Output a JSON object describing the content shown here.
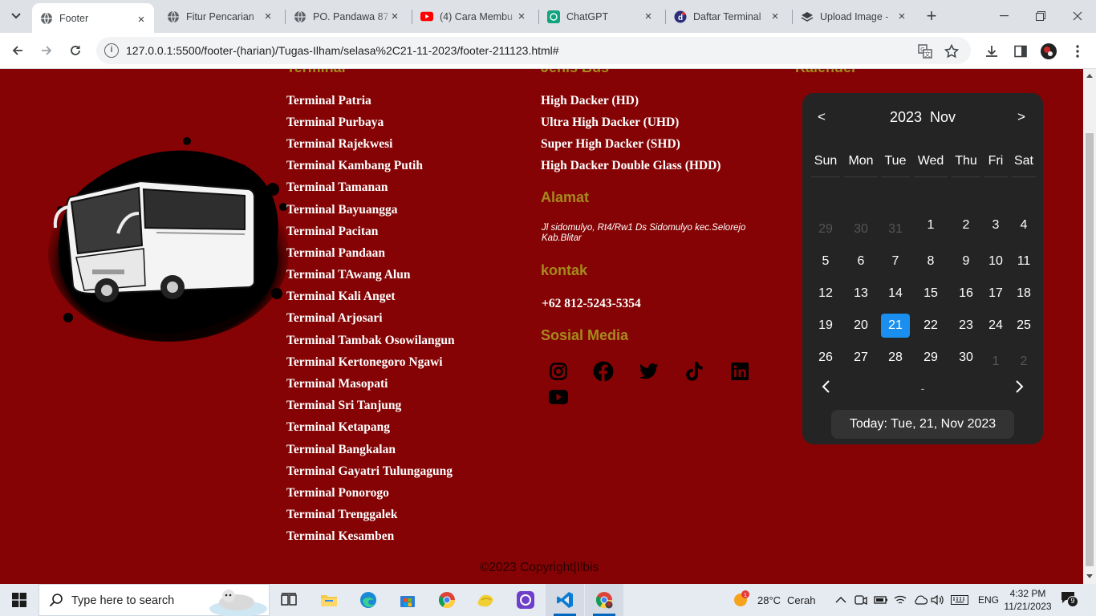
{
  "browser": {
    "tabs": [
      {
        "title": "Footer",
        "icon": "globe-icon",
        "active": true
      },
      {
        "title": "Fitur Pencarian",
        "icon": "globe-icon"
      },
      {
        "title": "PO. Pandawa 87",
        "icon": "globe-icon"
      },
      {
        "title": "(4) Cara Membu",
        "icon": "youtube-icon"
      },
      {
        "title": "ChatGPT",
        "icon": "chatgpt-icon"
      },
      {
        "title": "Daftar Terminal",
        "icon": "d-logo-icon"
      },
      {
        "title": "Upload Image -",
        "icon": "upload-icon"
      }
    ],
    "url": "127.0.0.1:5500/footer-(harian)/Tugas-Ilham/selasa%2C21-11-2023/footer-211123.html#"
  },
  "footer": {
    "terminal_heading": "Terminal",
    "terminals": [
      "Terminal Patria",
      "Terminal Purbaya",
      "Terminal Rajekwesi",
      "Terminal Kambang Putih",
      "Terminal Tamanan",
      "Terminal Bayuangga",
      "Terminal Pacitan",
      "Terminal Pandaan",
      "Terminal TAwang Alun",
      "Terminal Kali Anget",
      "Terminal Arjosari",
      "Terminal Tambak Osowilangun",
      "Terminal Kertonegoro Ngawi",
      "Terminal Masopati",
      "Terminal Sri Tanjung",
      "Terminal Ketapang",
      "Terminal Bangkalan",
      "Terminal Gayatri Tulungagung",
      "Terminal Ponorogo",
      "Terminal Trenggalek",
      "Terminal Kesamben"
    ],
    "jenis_heading": "Jenis Bus",
    "jenis": [
      "High Dacker (HD)",
      "Ultra High Dacker (UHD)",
      "Super High Dacker (SHD)",
      "High Dacker Double Glass (HDD)"
    ],
    "alamat_heading": "Alamat",
    "alamat": "Jl sidomulyo, Rt4/Rw1 Ds Sidomulyo kec.Selorejo Kab.Blitar",
    "kontak_heading": "kontak",
    "kontak": "+62 812-5243-5354",
    "sosmed_heading": "Sosial Media",
    "social_icons": [
      "instagram-icon",
      "facebook-icon",
      "twitter-icon",
      "tiktok-icon",
      "linkedin-icon",
      "youtube-icon"
    ],
    "kalender_heading": "Kalender",
    "copyright": "©2023 Copyright|Ilbis"
  },
  "calendar": {
    "prev": "<",
    "next": ">",
    "year": "2023",
    "month": "Nov",
    "weekdays": [
      "Sun",
      "Mon",
      "Tue",
      "Wed",
      "Thu",
      "Fri",
      "Sat"
    ],
    "weeks": [
      [
        "29",
        "30",
        "31",
        "1",
        "2",
        "3",
        "4"
      ],
      [
        "5",
        "6",
        "7",
        "8",
        "9",
        "10",
        "11"
      ],
      [
        "12",
        "13",
        "14",
        "15",
        "16",
        "17",
        "18"
      ],
      [
        "19",
        "20",
        "21",
        "22",
        "23",
        "24",
        "25"
      ],
      [
        "26",
        "27",
        "28",
        "29",
        "30",
        "1",
        "2"
      ]
    ],
    "selected_day": "21",
    "dash": "-",
    "today_label": "Today: Tue, 21, Nov 2023"
  },
  "taskbar": {
    "search_placeholder": "Type here to search",
    "weather_temp": "28°C",
    "weather_desc": "Cerah",
    "lang": "ENG",
    "time": "4:32 PM",
    "date": "11/21/2023",
    "notif_count": "9"
  },
  "colors": {
    "page_bg": "#850304",
    "heading": "#a68a1e",
    "calendar_bg": "#242424",
    "today_accent": "#1a8ff0"
  }
}
